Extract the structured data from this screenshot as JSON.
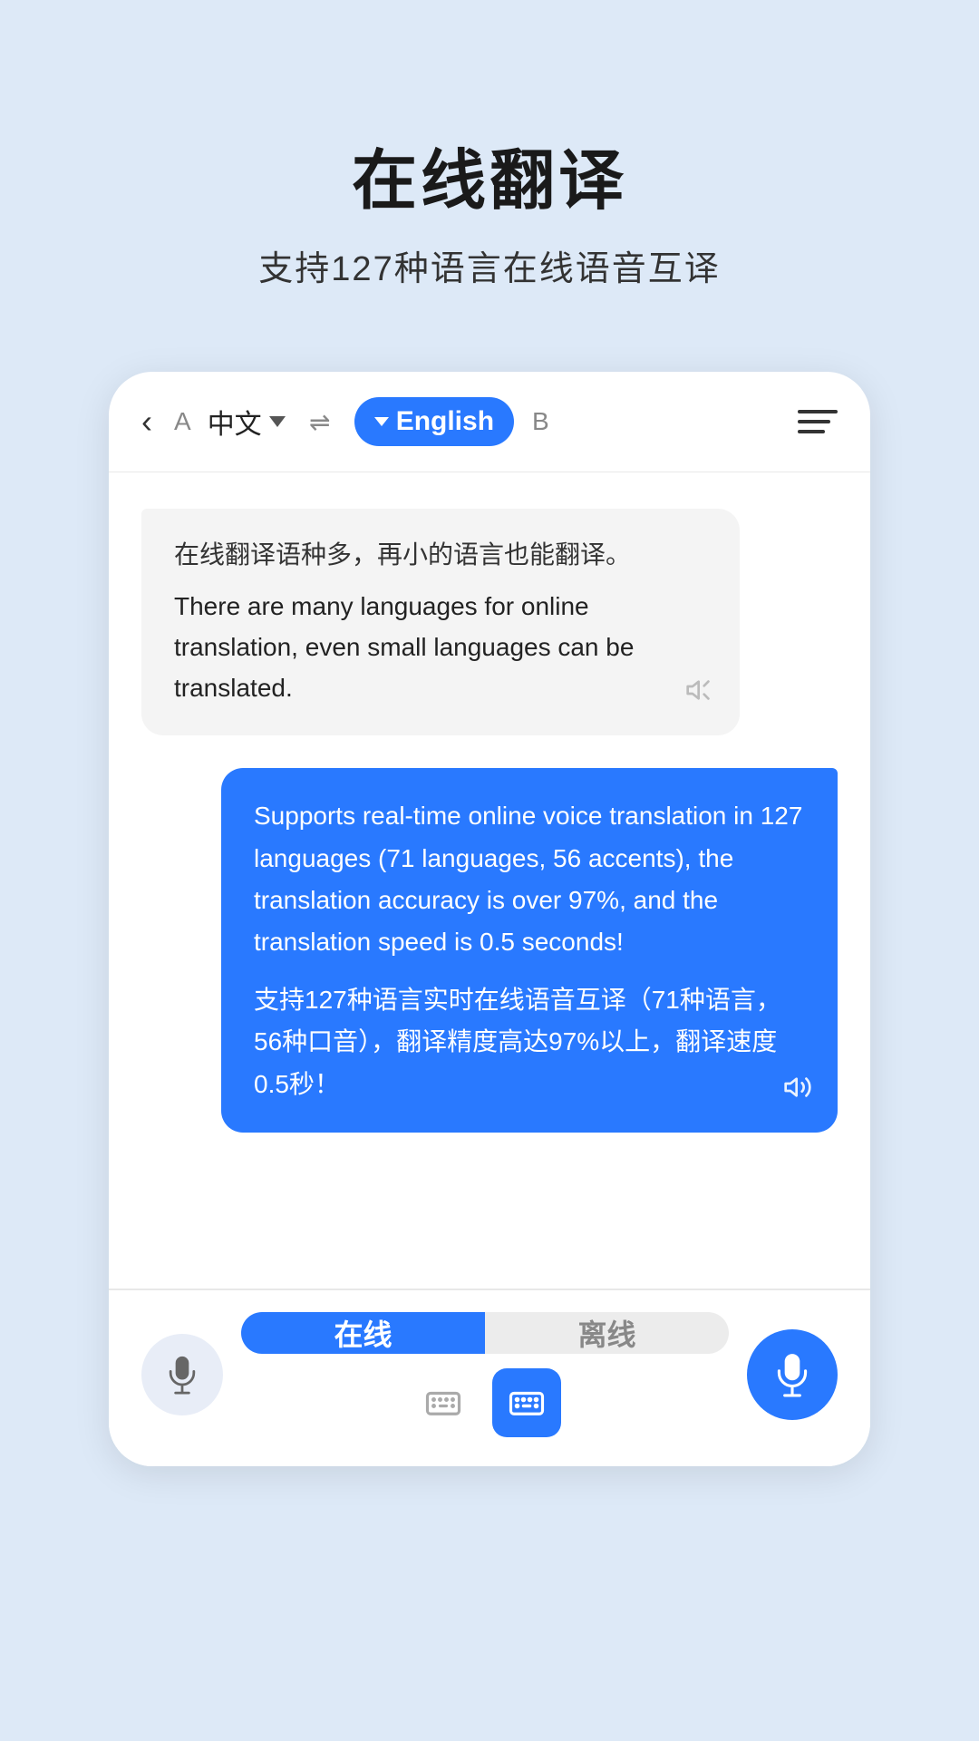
{
  "hero": {
    "title": "在线翻译",
    "subtitle": "支持127种语言在线语音互译"
  },
  "nav": {
    "back_label": "‹",
    "lang_a_label": "A",
    "lang_source": "中文",
    "lang_target": "English",
    "lang_b_label": "B"
  },
  "chat": {
    "bubble_left": {
      "source": "在线翻译语种多，再小的语言也能翻译。",
      "translation": "There are many languages for online translation, even small languages can be translated."
    },
    "bubble_right": {
      "english": "Supports real-time online voice translation in 127 languages (71 languages, 56 accents), the translation accuracy is over 97%, and the translation speed is 0.5 seconds!",
      "chinese": "支持127种语言实时在线语音互译（71种语言，56种口音），翻译精度高达97%以上，翻译速度0.5秒！"
    }
  },
  "toolbar": {
    "mode_online": "在线",
    "mode_offline": "离线"
  }
}
